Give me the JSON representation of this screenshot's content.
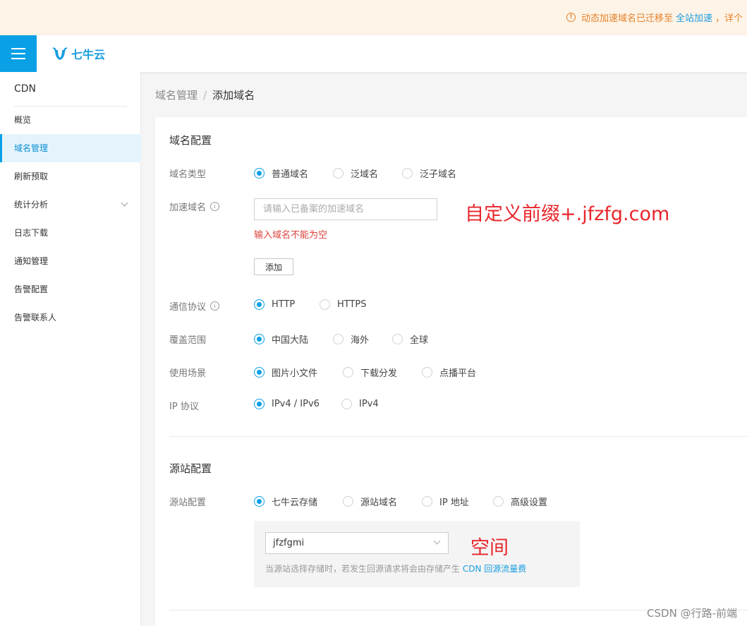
{
  "notice": {
    "text": "动态加速域名已迁移至",
    "link": "全站加速",
    "tail": "，详个"
  },
  "header": {
    "logo_text": "七牛云",
    "accent": "#0aa0e6"
  },
  "sidebar": {
    "title": "CDN",
    "items": [
      {
        "label": "概览"
      },
      {
        "label": "域名管理",
        "active": true
      },
      {
        "label": "刷新预取"
      },
      {
        "label": "统计分析",
        "expandable": true
      },
      {
        "label": "日志下载"
      },
      {
        "label": "通知管理"
      },
      {
        "label": "告警配置"
      },
      {
        "label": "告警联系人"
      }
    ]
  },
  "breadcrumb": {
    "parent": "域名管理",
    "separator": "/",
    "current": "添加域名"
  },
  "domain_config": {
    "title": "域名配置",
    "type": {
      "label": "域名类型",
      "options": [
        "普通域名",
        "泛域名",
        "泛子域名"
      ],
      "selected": "普通域名"
    },
    "accel_domain": {
      "label": "加速域名",
      "placeholder": "请输入已备案的加速域名",
      "value": "",
      "error": "输入域名不能为空",
      "add_button": "添加"
    },
    "protocol": {
      "label": "通信协议",
      "options": [
        "HTTP",
        "HTTPS"
      ],
      "selected": "HTTP"
    },
    "coverage": {
      "label": "覆盖范围",
      "options": [
        "中国大陆",
        "海外",
        "全球"
      ],
      "selected": "中国大陆"
    },
    "scenario": {
      "label": "使用场景",
      "options": [
        "图片小文件",
        "下载分发",
        "点播平台"
      ],
      "selected": "图片小文件"
    },
    "ip_protocol": {
      "label": "IP 协议",
      "options": [
        "IPv4 / IPv6",
        "IPv4"
      ],
      "selected": "IPv4 / IPv6"
    }
  },
  "origin_config": {
    "title": "源站配置",
    "source": {
      "label": "源站配置",
      "options": [
        "七牛云存储",
        "源站域名",
        "IP 地址",
        "高级设置"
      ],
      "selected": "七牛云存储"
    },
    "bucket": {
      "value": "jfzfgmi",
      "hint": "当源站选择存储时，若发生回源请求将会由存储产生",
      "hint_link": "CDN 回源流量费"
    }
  },
  "annotations": {
    "domain_note": "自定义前缀+.jfzfg.com",
    "bucket_note": "空间",
    "color": "#e8262b"
  },
  "watermark": "CSDN @行路-前端"
}
